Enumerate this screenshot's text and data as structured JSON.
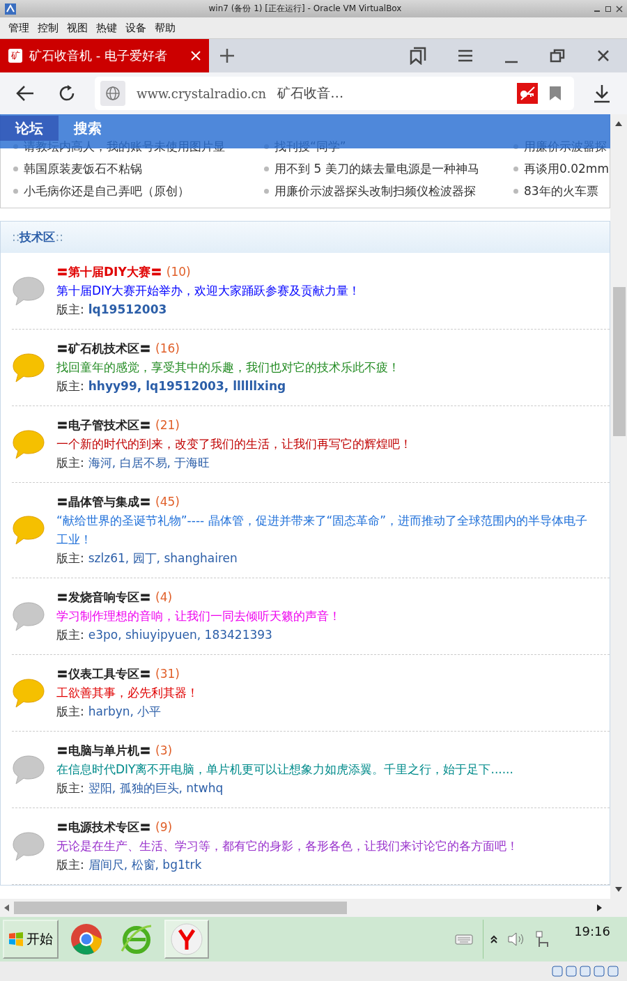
{
  "window": {
    "title": "win7 (备份 1) [正在运行] - Oracle VM VirtualBox"
  },
  "menu": [
    "管理",
    "控制",
    "视图",
    "热键",
    "设备",
    "帮助"
  ],
  "browser": {
    "tab_title": "矿石收音机 - 电子爱好者",
    "tab_icon": "矿",
    "url": "www.crystalradio.cn",
    "page_title": "矿石收音…"
  },
  "nav": [
    {
      "label": "论坛",
      "selected": true
    },
    {
      "label": "搜索",
      "selected": false
    }
  ],
  "latest_posts": [
    [
      "请教坛内高人，我的账号未使用图片显",
      "找刊授“同学”",
      "用廉价示波器探"
    ],
    [
      "韩国原装麦饭石不粘锅",
      "用不到 5 美刀的婊去量电源是一种神马",
      "再谈用0.02mm"
    ],
    [
      "小毛病你还是自己弄吧（原创）",
      "用廉价示波器探头改制扫频仪检波器探",
      "83年的火车票"
    ]
  ],
  "section": {
    "title": "::**技术区**::"
  },
  "forums": [
    {
      "title": "〓第十届DIY大赛〓",
      "highlight": true,
      "count": "(10)",
      "new": false,
      "description": "第十届DIY大赛开始举办，欢迎大家踊跃参赛及贡献力量！",
      "color": "#0000ff",
      "moderators_label": "版主:",
      "moderators": "lq19512003",
      "bold": true
    },
    {
      "title": "〓矿石机技术区〓",
      "highlight": false,
      "count": "(16)",
      "new": true,
      "description": "找回童年的感觉，享受其中的乐趣，我们也对它的技术乐此不疲！",
      "color": "#228b22",
      "moderators_label": "版主:",
      "moderators": "hhyy99, lq19512003, llllllxing",
      "bold": true
    },
    {
      "title": "〓电子管技术区〓",
      "highlight": false,
      "count": "(21)",
      "new": true,
      "description": "一个新的时代的到来，改变了我们的生活，让我们再写它的辉煌吧！",
      "color": "#c00000",
      "moderators_label": "版主:",
      "moderators": "海河, 白居不易, 于海旺",
      "bold": false
    },
    {
      "title": "〓晶体管与集成〓",
      "highlight": false,
      "count": "(45)",
      "new": true,
      "description": "“献给世界的圣诞节礼物”---- 晶体管，促进并带来了“固态革命”，进而推动了全球范围内的半导体电子工业！",
      "color": "#1e6fd9",
      "moderators_label": "版主:",
      "moderators": "szlz61, 园丁, shanghairen",
      "bold": false
    },
    {
      "title": "〓发烧音响专区〓",
      "highlight": false,
      "count": "(4)",
      "new": false,
      "description": "学习制作理想的音响，让我们一同去倾听天籁的声音！",
      "color": "#ee00ee",
      "moderators_label": "版主:",
      "moderators": "e3po, shiuyipyuen, 183421393",
      "bold": false
    },
    {
      "title": "〓仪表工具专区〓",
      "highlight": false,
      "count": "(31)",
      "new": true,
      "description": "工欲善其事，必先利其器！",
      "color": "#e00000",
      "moderators_label": "版主:",
      "moderators": "harbyn, 小平",
      "bold": false
    },
    {
      "title": "〓电脑与单片机〓",
      "highlight": false,
      "count": "(3)",
      "new": false,
      "description": "在信息时代DIY离不开电脑，单片机更可以让想象力如虎添翼。千里之行，始于足下......",
      "color": "#008b8b",
      "moderators_label": "版主:",
      "moderators": "翌阳, 孤独的巨头, ntwhq",
      "bold": false
    },
    {
      "title": "〓电源技术专区〓",
      "highlight": false,
      "count": "(9)",
      "new": false,
      "description": "无论是在生产、生活、学习等，都有它的身影，各形各色，让我们来讨论它的各方面吧！",
      "color": "#9932cc",
      "moderators_label": "版主:",
      "moderators": "眉间尺, 松窗, bg1trk",
      "bold": false
    }
  ],
  "taskbar": {
    "start": "开始",
    "apps": [
      {
        "kind": "chrome",
        "selected": false
      },
      {
        "kind": "ie",
        "selected": false
      },
      {
        "kind": "yandex",
        "selected": true
      }
    ],
    "time": "19:16"
  }
}
